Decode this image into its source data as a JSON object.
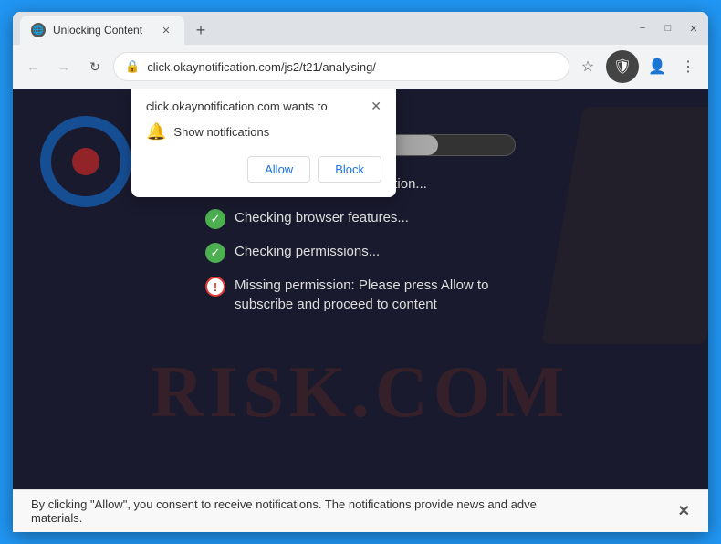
{
  "browser": {
    "tab": {
      "title": "Unlocking Content",
      "icon": "🌐"
    },
    "new_tab_icon": "+",
    "window_controls": {
      "minimize": "−",
      "maximize": "□",
      "close": "✕"
    },
    "address": "click.okaynotification.com/js2/t21/analysing/",
    "back_icon": "←",
    "forward_icon": "→",
    "reload_icon": "↻",
    "star_icon": "☆",
    "profile_icon": "👤",
    "menu_icon": "⋮",
    "shield_icon": "🛡"
  },
  "popup": {
    "title": "click.okaynotification.com wants to",
    "close_icon": "✕",
    "notification_label": "Show notifications",
    "bell_icon": "🔔",
    "allow_button": "Allow",
    "block_button": "Block"
  },
  "page": {
    "progress_width": "75%",
    "watermark": "RISK.COM",
    "checks": [
      {
        "type": "green",
        "icon": "✓",
        "text": "Checking browser information..."
      },
      {
        "type": "green",
        "icon": "✓",
        "text": "Checking browser features..."
      },
      {
        "type": "green",
        "icon": "✓",
        "text": "Checking permissions..."
      },
      {
        "type": "warning",
        "icon": "!",
        "text": "Missing permission: Please press Allow to subscribe and proceed to content"
      }
    ]
  },
  "bottom_bar": {
    "text": "By clicking \"Allow\", you consent to receive notifications. The notifications provide news and adve",
    "text2": "materials.",
    "close_icon": "✕"
  }
}
